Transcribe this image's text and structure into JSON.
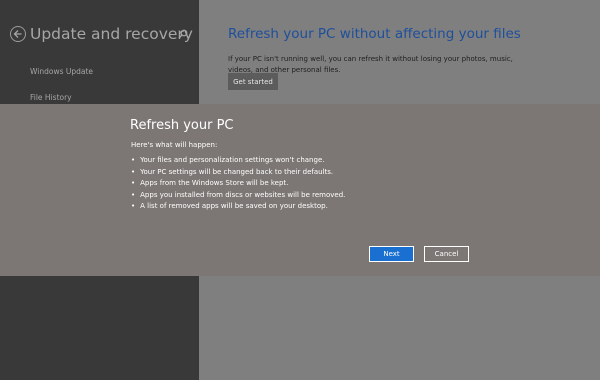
{
  "sidebar": {
    "title": "Update and recovery",
    "items": [
      {
        "label": "Windows Update"
      },
      {
        "label": "File History"
      }
    ]
  },
  "main": {
    "title": "Refresh your PC without affecting your files",
    "description": "If your PC isn't running well, you can refresh it without losing your photos, music, videos, and other personal files.",
    "get_started_label": "Get started"
  },
  "dialog": {
    "title": "Refresh your PC",
    "intro": "Here's what will happen:",
    "bullets": [
      "Your files and personalization settings won't change.",
      "Your PC settings will be changed back to their defaults.",
      "Apps from the Windows Store will be kept.",
      "Apps you installed from discs or websites will be removed.",
      "A list of removed apps will be saved on your desktop."
    ],
    "next_label": "Next",
    "cancel_label": "Cancel"
  },
  "colors": {
    "sidebar_bg": "#393939",
    "dialog_bg": "#7c7774",
    "accent": "#1a70d0",
    "title_blue": "#1e4f9c"
  },
  "icons": [
    "back-arrow-icon",
    "search-icon"
  ]
}
